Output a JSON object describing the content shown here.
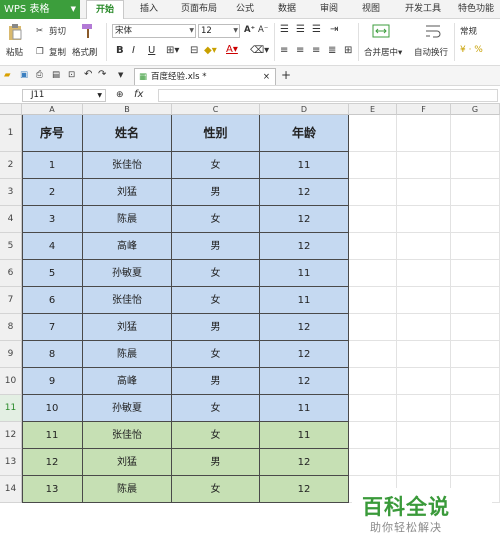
{
  "menubar": {
    "app": "WPS 表格",
    "tabs": [
      "开始",
      "插入",
      "页面布局",
      "公式",
      "数据",
      "审阅",
      "视图",
      "开发工具",
      "特色功能"
    ],
    "active_tab": "开始"
  },
  "ribbon": {
    "paste": "粘贴",
    "cut": "剪切",
    "copy": "复制",
    "format_painter": "格式刷",
    "font_name": "宋体",
    "font_size": "12",
    "merge_center": "合并居中",
    "wrap_text": "自动换行",
    "number_format": "常规",
    "bold": "B",
    "italic": "I",
    "underline": "U"
  },
  "doc_tab": {
    "title": "百度经验.xls *"
  },
  "formula_bar": {
    "cell_ref": "J11",
    "fx": "fx"
  },
  "sheet": {
    "columns": [
      "A",
      "B",
      "C",
      "D",
      "E",
      "F",
      "G"
    ],
    "header": [
      "序号",
      "姓名",
      "性别",
      "年龄"
    ],
    "rows": [
      [
        "1",
        "张佳怡",
        "女",
        "11"
      ],
      [
        "2",
        "刘猛",
        "男",
        "12"
      ],
      [
        "3",
        "陈晨",
        "女",
        "12"
      ],
      [
        "4",
        "高峰",
        "男",
        "12"
      ],
      [
        "5",
        "孙敏夏",
        "女",
        "11"
      ],
      [
        "6",
        "张佳怡",
        "女",
        "11"
      ],
      [
        "7",
        "刘猛",
        "男",
        "12"
      ],
      [
        "8",
        "陈晨",
        "女",
        "12"
      ],
      [
        "9",
        "高峰",
        "男",
        "12"
      ],
      [
        "10",
        "孙敏夏",
        "女",
        "11"
      ],
      [
        "11",
        "张佳怡",
        "女",
        "11"
      ],
      [
        "12",
        "刘猛",
        "男",
        "12"
      ],
      [
        "13",
        "陈晨",
        "女",
        "12"
      ]
    ],
    "row_numbers": [
      "1",
      "2",
      "3",
      "4",
      "5",
      "6",
      "7",
      "8",
      "9",
      "10",
      "11",
      "12",
      "13",
      "14"
    ],
    "selected_row": "11",
    "colors": {
      "blue_fill": "#c5d9f1",
      "green_fill": "#c6e0b4",
      "accent": "#3c9e3c"
    }
  },
  "watermark": {
    "title": "百科全说",
    "subtitle": "助你轻松解决"
  }
}
